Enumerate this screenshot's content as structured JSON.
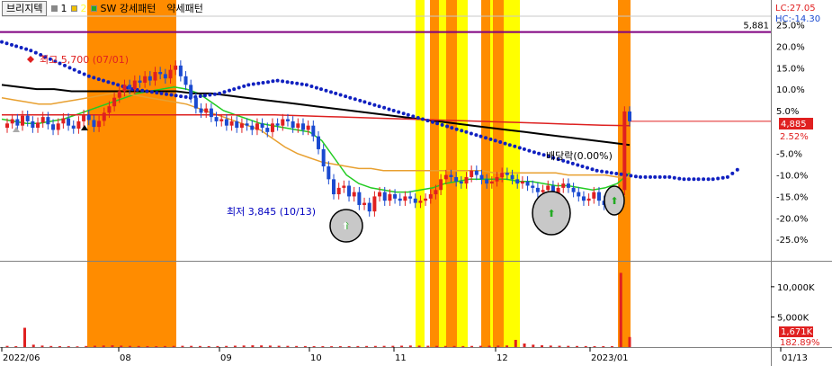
{
  "toolbar": {
    "stock_name": "브리지텍",
    "items": [
      {
        "label": "1",
        "color": "#000000",
        "marker": "#888888"
      },
      {
        "label": "2",
        "color": "#FFFF33",
        "marker": "#f0c000"
      },
      {
        "label": "SW 강세패턴",
        "color": "#000000",
        "marker": "#22aa22"
      },
      {
        "label": "약세패턴",
        "color": "#000000",
        "marker": ""
      }
    ]
  },
  "chart_data": [
    {
      "type": "candlestick",
      "panel": "price",
      "y_axis_unit": "% (relative)",
      "ylim": [
        -30,
        27
      ],
      "y_ticks": [
        "25.0%",
        "20.0%",
        "15.0%",
        "10.0%",
        "5.0%",
        "2.52%",
        "-5.0%",
        "-10.0%",
        "-15.0%",
        "-20.0%",
        "-25.0%"
      ],
      "x_ticks": [
        "2022/06",
        "08",
        "09",
        "10",
        "11",
        "12",
        "2023/01",
        "01/13"
      ],
      "corner_labels": {
        "lc": "LC:27.05",
        "hc": "HC:-14.30"
      },
      "reference_line": {
        "value_label": "5,881",
        "pct": 23.3,
        "color": "#800080"
      },
      "current_price": {
        "label": "4,885",
        "pct_label": "2.52%",
        "color": "#e02020"
      },
      "annotations": [
        {
          "text": "최고 5,700 (07/01)",
          "color": "#e02020"
        },
        {
          "text": "최저 3,845 (10/13)",
          "color": "#0000c0"
        },
        {
          "text": "배당락(0.00%)",
          "color": "#000000"
        }
      ],
      "series": [
        {
          "name": "1",
          "color": "#000000"
        },
        {
          "name": "2",
          "color": "#FFFF33"
        }
      ],
      "strong_pattern_bands_color": "#FF8C00",
      "weak_pattern_bands_color": "#FFFF00",
      "closes": [
        2.0,
        3.0,
        1.5,
        3.8,
        2.5,
        1.0,
        2.2,
        3.5,
        1.8,
        0.5,
        2.0,
        3.2,
        1.5,
        0.8,
        2.5,
        4.0,
        2.8,
        1.2,
        2.6,
        4.5,
        6.0,
        8.0,
        9.5,
        11.0,
        10.0,
        12.0,
        11.5,
        13.0,
        12.0,
        14.0,
        13.5,
        12.5,
        14.5,
        15.5,
        13.0,
        11.0,
        8.0,
        5.5,
        4.5,
        5.5,
        3.5,
        2.5,
        3.0,
        1.5,
        2.5,
        1.0,
        2.0,
        1.5,
        0.5,
        2.0,
        1.0,
        0.0,
        2.0,
        1.5,
        3.0,
        2.5,
        1.0,
        2.0,
        0.5,
        1.5,
        -1.0,
        -4.0,
        -8.0,
        -11.0,
        -14.5,
        -13.0,
        -12.5,
        -15.0,
        -14.0,
        -17.0,
        -16.5,
        -18.5,
        -15.0,
        -14.0,
        -16.0,
        -14.5,
        -15.5,
        -16.0,
        -15.0,
        -15.5,
        -16.5,
        -16.0,
        -15.5,
        -14.5,
        -13.5,
        -11.0,
        -10.0,
        -10.5,
        -11.5,
        -12.0,
        -10.5,
        -9.0,
        -10.0,
        -11.0,
        -12.0,
        -11.5,
        -10.5,
        -9.5,
        -10.0,
        -11.0,
        -12.0,
        -11.5,
        -12.5,
        -13.0,
        -14.0,
        -13.5,
        -12.5,
        -14.5,
        -13.0,
        -12.0,
        -13.0,
        -14.0,
        -15.0,
        -16.0,
        -15.5,
        -14.0,
        -16.0,
        -17.0,
        -16.5,
        -15.0,
        -13.5,
        4.8,
        2.5
      ],
      "moving_averages": [
        {
          "name": "MA-short",
          "color": "#22cc22",
          "points": [
            3,
            2.5,
            2,
            2,
            2.5,
            3,
            4,
            5,
            6,
            7,
            8,
            9,
            9.5,
            10,
            10.5,
            10,
            9,
            7,
            5,
            4,
            3,
            2,
            1.5,
            1,
            0.5,
            0,
            -2,
            -6,
            -10,
            -12,
            -13,
            -13.5,
            -14,
            -14,
            -13.5,
            -13,
            -12,
            -11.5,
            -11,
            -11,
            -11,
            -11,
            -11.5,
            -11.5,
            -12,
            -12.5,
            -12.5,
            -13,
            -13.5,
            -13,
            -12,
            -9.5
          ]
        },
        {
          "name": "MA-mid",
          "color": "#e8a030",
          "points": [
            8,
            7.5,
            7,
            6.5,
            6.5,
            7,
            7.5,
            8,
            8.5,
            9,
            9,
            8.5,
            8,
            7.5,
            7,
            6.5,
            5.5,
            4.5,
            3.5,
            2.5,
            1.5,
            0.5,
            -1.5,
            -3.5,
            -5,
            -6,
            -7,
            -7.5,
            -8,
            -8.5,
            -8.5,
            -9,
            -9,
            -9,
            -9,
            -9,
            -9,
            -9,
            -9,
            -9,
            -9.5,
            -9.5,
            -9.5,
            -9.5,
            -9.5,
            -9.5,
            -10,
            -10,
            -10,
            -10,
            -10.5,
            -10.5
          ]
        },
        {
          "name": "MA-long",
          "color": "#000000",
          "points": [
            11,
            10.5,
            10,
            10,
            9.5,
            9.5,
            9.5,
            9.5,
            9.5,
            9.5,
            9.5,
            9,
            9,
            8.5,
            8,
            7.5,
            7,
            6.5,
            6,
            5.5,
            5,
            4.5,
            4,
            3.5,
            3,
            2.5,
            2,
            1.5,
            1,
            0.5,
            0,
            -0.5,
            -1,
            -1.5,
            -2,
            -2.5,
            -3
          ]
        },
        {
          "name": "MA-trend",
          "color": "#dd2020",
          "points": [
            4,
            4,
            4,
            4,
            4,
            4,
            4,
            4,
            4,
            4,
            4,
            3.8,
            3.6,
            3.4,
            3.2,
            3,
            2.8,
            2.6,
            2.4,
            2.2,
            2,
            1.8,
            1.6,
            1.5
          ]
        },
        {
          "name": "envelope-dots",
          "color": "#1020c0",
          "points": [
            21,
            20,
            19,
            17.5,
            16,
            14.5,
            13,
            12,
            11,
            10,
            9.5,
            9,
            8.5,
            8,
            8.5,
            9,
            10,
            11,
            11.5,
            12,
            11.5,
            11,
            10,
            9,
            8,
            7,
            6,
            5,
            4,
            3,
            2,
            1,
            0,
            -1,
            -2,
            -3,
            -4,
            -5,
            -6,
            -7,
            -8,
            -9,
            -9.5,
            -10,
            -10.5,
            -10.5,
            -10.5,
            -11,
            -11,
            -11,
            -10.5,
            -8
          ]
        }
      ]
    },
    {
      "type": "bar",
      "panel": "volume",
      "y_ticks": [
        "10,000K",
        "5,000K"
      ],
      "ylim": [
        0,
        14000
      ],
      "current_volume": {
        "label": "1,671K",
        "pct_label": "182.89%"
      },
      "values": [
        200,
        150,
        3200,
        400,
        250,
        180,
        160,
        140,
        120,
        180,
        220,
        260,
        300,
        240,
        200,
        180,
        160,
        150,
        170,
        190,
        210,
        200,
        180,
        160,
        170,
        190,
        230,
        260,
        300,
        280,
        250,
        220,
        200,
        180,
        170,
        160,
        150,
        140,
        150,
        160,
        170,
        180,
        190,
        200,
        210,
        230,
        260,
        240,
        220,
        200,
        190,
        180,
        170,
        190,
        210,
        230,
        250,
        270,
        1200,
        600,
        400,
        300,
        250,
        220,
        200,
        180,
        170,
        160,
        150,
        150,
        12300,
        1671
      ]
    }
  ]
}
